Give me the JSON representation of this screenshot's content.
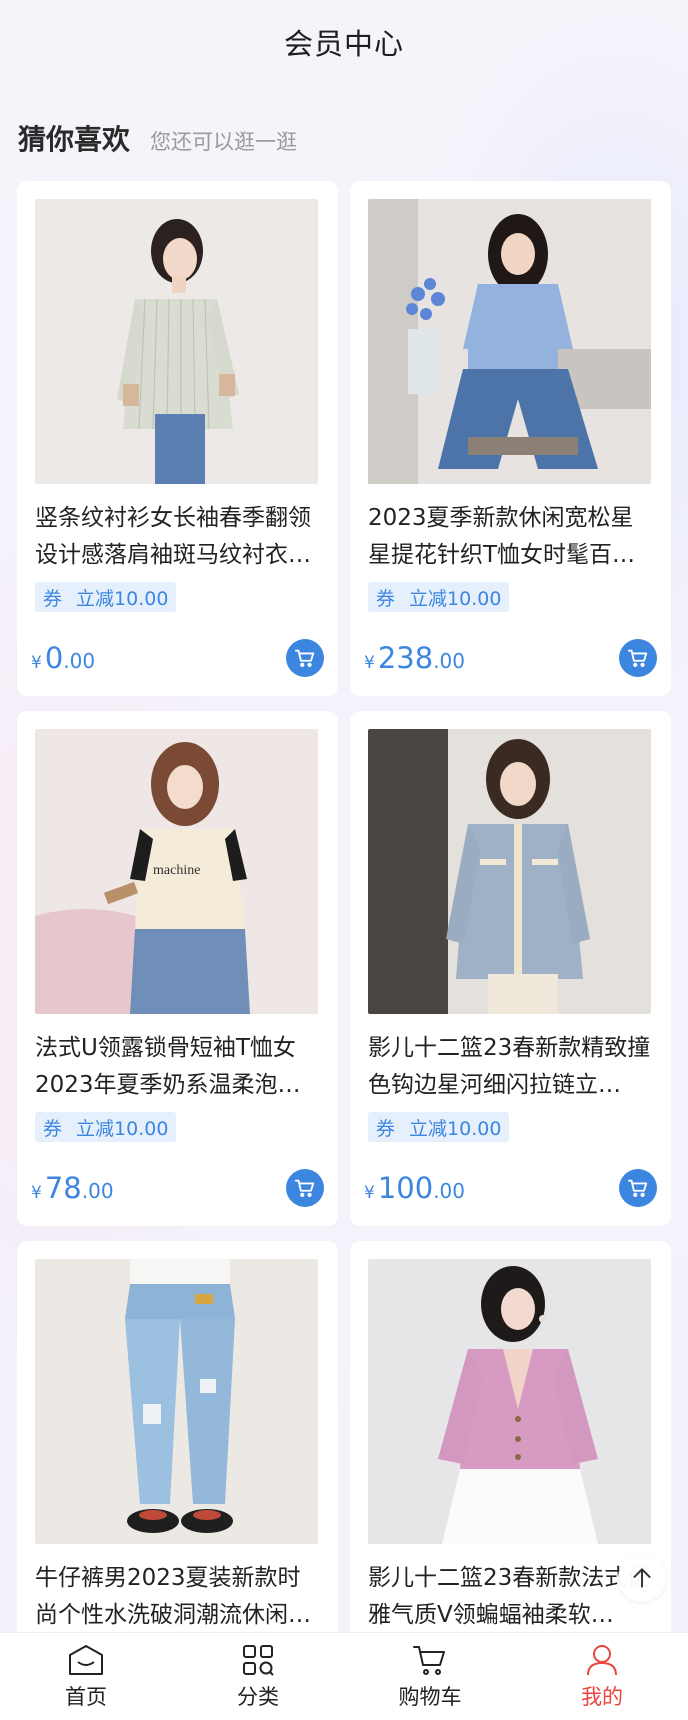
{
  "header": {
    "title": "会员中心"
  },
  "section": {
    "title": "猜你喜欢",
    "subtitle": "您还可以逛一逛"
  },
  "products": [
    {
      "title": "竖条纹衬衫女长袖春季翻领设计感落肩袖斑马纹衬衣…",
      "coupon_tag": "券",
      "coupon_text": "立减10.00",
      "currency": "¥",
      "price_int": "0",
      "price_dec": ".00",
      "image": "photo-striped-shirt-woman"
    },
    {
      "title": "2023夏季新款休闲宽松星星提花针织T恤女时髦百…",
      "coupon_tag": "券",
      "coupon_text": "立减10.00",
      "currency": "¥",
      "price_int": "238",
      "price_dec": ".00",
      "image": "photo-blue-knit-tee-woman"
    },
    {
      "title": "法式U领露锁骨短袖T恤女2023年夏季奶系温柔泡…",
      "coupon_tag": "券",
      "coupon_text": "立减10.00",
      "currency": "¥",
      "price_int": "78",
      "price_dec": ".00",
      "image": "photo-cream-tee-woman"
    },
    {
      "title": "影儿十二篮23春新款精致撞色钩边星河细闪拉链立…",
      "coupon_tag": "券",
      "coupon_text": "立减10.00",
      "currency": "¥",
      "price_int": "100",
      "price_dec": ".00",
      "image": "photo-grey-cardigan-woman"
    },
    {
      "title": "牛仔裤男2023夏装新款时尚个性水洗破洞潮流休闲…",
      "image": "photo-ripped-jeans"
    },
    {
      "title": "影儿十二篮23春新款法式优雅气质V领蝙蝠袖柔软…",
      "image": "photo-pink-cardigan-woman"
    }
  ],
  "tabbar": {
    "items": [
      {
        "label": "首页",
        "icon": "home-icon",
        "active": false
      },
      {
        "label": "分类",
        "icon": "category-icon",
        "active": false
      },
      {
        "label": "购物车",
        "icon": "cart-icon",
        "active": false
      },
      {
        "label": "我的",
        "icon": "user-icon",
        "active": true
      }
    ]
  },
  "colors": {
    "accent": "#3d86e0",
    "active_tab": "#e8463e",
    "coupon_bg": "#e6f0fd"
  }
}
